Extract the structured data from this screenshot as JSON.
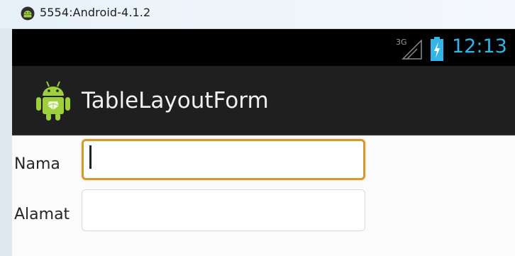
{
  "window": {
    "title": "5554:Android-4.1.2",
    "icon": "android-emulator-icon"
  },
  "status_bar": {
    "network": "3G",
    "time": "12:13",
    "clock_color": "#33b5e5",
    "icons": [
      "signal-3g-icon",
      "battery-charging-icon"
    ]
  },
  "action_bar": {
    "title": "TableLayoutForm",
    "icon": "android-app-icon"
  },
  "form": {
    "rows": [
      {
        "label": "Nama",
        "value": "",
        "focused": true
      },
      {
        "label": "Alamat",
        "value": "",
        "focused": false
      }
    ],
    "focus_color": "#d39a2e"
  }
}
